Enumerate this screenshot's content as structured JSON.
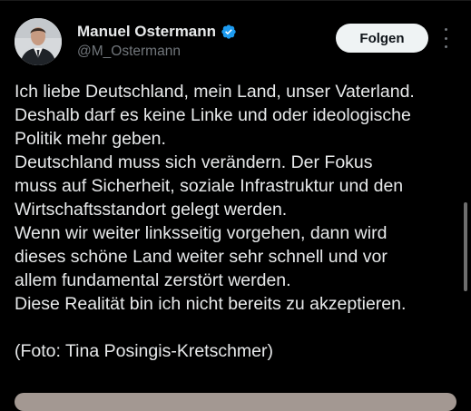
{
  "author": {
    "display_name": "Manuel Ostermann",
    "handle": "@M_Ostermann",
    "verified": true,
    "avatar_icon": "profile-photo"
  },
  "actions": {
    "follow_label": "Folgen",
    "more_icon": "more-options-vertical-icon"
  },
  "tweet": {
    "lines": [
      "Ich liebe Deutschland, mein Land, unser Vaterland.",
      "Deshalb darf es keine Linke und oder ideologische",
      "Politik mehr geben.",
      "Deutschland muss sich verändern. Der Fokus",
      "muss auf Sicherheit, soziale Infrastruktur und den",
      "Wirtschaftsstandort gelegt werden.",
      "Wenn wir weiter linksseitig vorgehen, dann wird",
      "dieses schöne Land weiter sehr schnell und vor",
      "allem fundamental zerstört werden.",
      "Diese Realität bin ich nicht bereits zu akzeptieren.",
      "",
      "(Foto: Tina Posingis-Kretschmer)"
    ]
  },
  "colors": {
    "background": "#000000",
    "text": "#e7e9ea",
    "secondary_text": "#71767b",
    "verified_blue": "#1d9bf0",
    "follow_button_bg": "#eff3f4",
    "follow_button_text": "#0f1419"
  }
}
